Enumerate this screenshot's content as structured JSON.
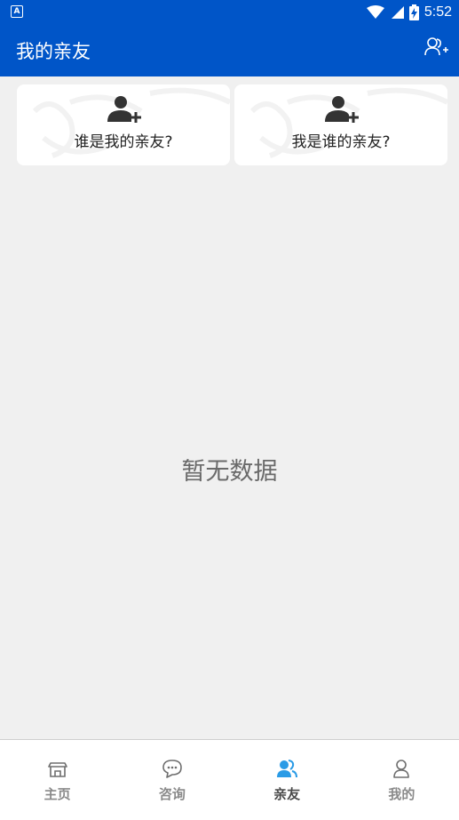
{
  "status_bar": {
    "left_icon_letter": "A",
    "time": "5:52",
    "icons": [
      "wifi-icon",
      "signal-icon",
      "battery-charging-icon"
    ]
  },
  "app_bar": {
    "title": "我的亲友",
    "action_icon": "add-contacts-icon"
  },
  "cards": [
    {
      "label": "谁是我的亲友?",
      "icon": "add-person-icon"
    },
    {
      "label": "我是谁的亲友?",
      "icon": "add-person-icon"
    }
  ],
  "empty_state": {
    "text": "暂无数据"
  },
  "bottom_nav": {
    "items": [
      {
        "label": "主页",
        "icon": "home-icon",
        "active": false
      },
      {
        "label": "咨询",
        "icon": "chat-icon",
        "active": false
      },
      {
        "label": "亲友",
        "icon": "friends-icon",
        "active": true
      },
      {
        "label": "我的",
        "icon": "profile-icon",
        "active": false
      }
    ]
  },
  "colors": {
    "primary": "#0055c8",
    "background": "#f0f0f0",
    "active_icon": "#2a9be6",
    "inactive_icon": "#6e6e6e"
  }
}
